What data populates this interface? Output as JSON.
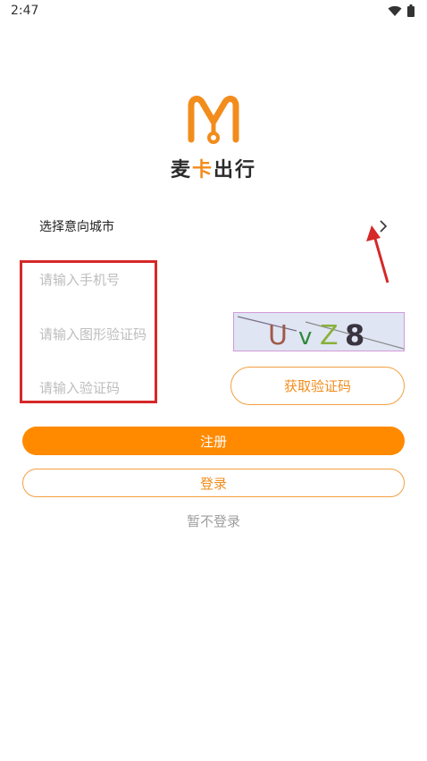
{
  "status_bar": {
    "time": "2:47"
  },
  "logo": {
    "text_part1": "麦",
    "text_part2": "卡",
    "text_part3": "出行",
    "brand_color": "#f28c1c"
  },
  "city": {
    "label": "选择意向城市"
  },
  "form": {
    "phone_placeholder": "请输入手机号",
    "captcha_placeholder": "请输入图形验证码",
    "code_placeholder": "请输入验证码",
    "captcha_chars": [
      "U",
      "v",
      "Z",
      "8"
    ]
  },
  "buttons": {
    "get_code": "获取验证码",
    "register": "注册",
    "login": "登录",
    "skip": "暂不登录"
  },
  "colors": {
    "accent": "#ff8a00",
    "annotation": "#d62828"
  }
}
